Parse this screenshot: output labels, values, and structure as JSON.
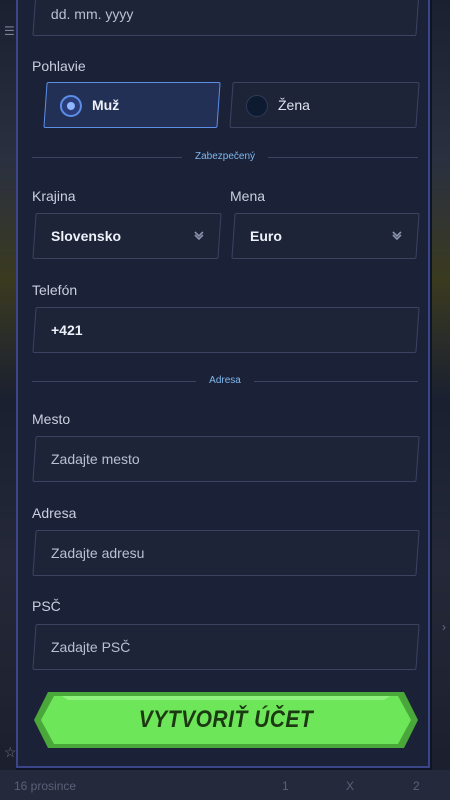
{
  "form": {
    "date_placeholder": "dd. mm. yyyy",
    "gender": {
      "label": "Pohlavie",
      "options": [
        {
          "label": "Muž",
          "selected": true
        },
        {
          "label": "Žena",
          "selected": false
        }
      ]
    },
    "section_secured": "Zabezpečený",
    "country": {
      "label": "Krajina",
      "value": "Slovensko",
      "icon": "chevron-down-icon"
    },
    "currency": {
      "label": "Mena",
      "value": "Euro",
      "icon": "chevron-down-icon"
    },
    "phone": {
      "label": "Telefón",
      "value": "+421"
    },
    "section_address": "Adresa",
    "city": {
      "label": "Mesto",
      "placeholder": "Zadajte mesto"
    },
    "address": {
      "label": "Adresa",
      "placeholder": "Zadajte adresu"
    },
    "postal": {
      "label": "PSČ",
      "placeholder": "Zadajte PSČ"
    },
    "submit_label": "VYTVORIŤ ÚČET"
  },
  "background": {
    "date_text": "16 prosince",
    "odds_labels": [
      "1",
      "X",
      "2"
    ]
  },
  "colors": {
    "accent": "#5c8ee8",
    "cta_green": "#6ee65a",
    "section_title": "#7fb8ee",
    "modal_bg": "#1b2238"
  }
}
